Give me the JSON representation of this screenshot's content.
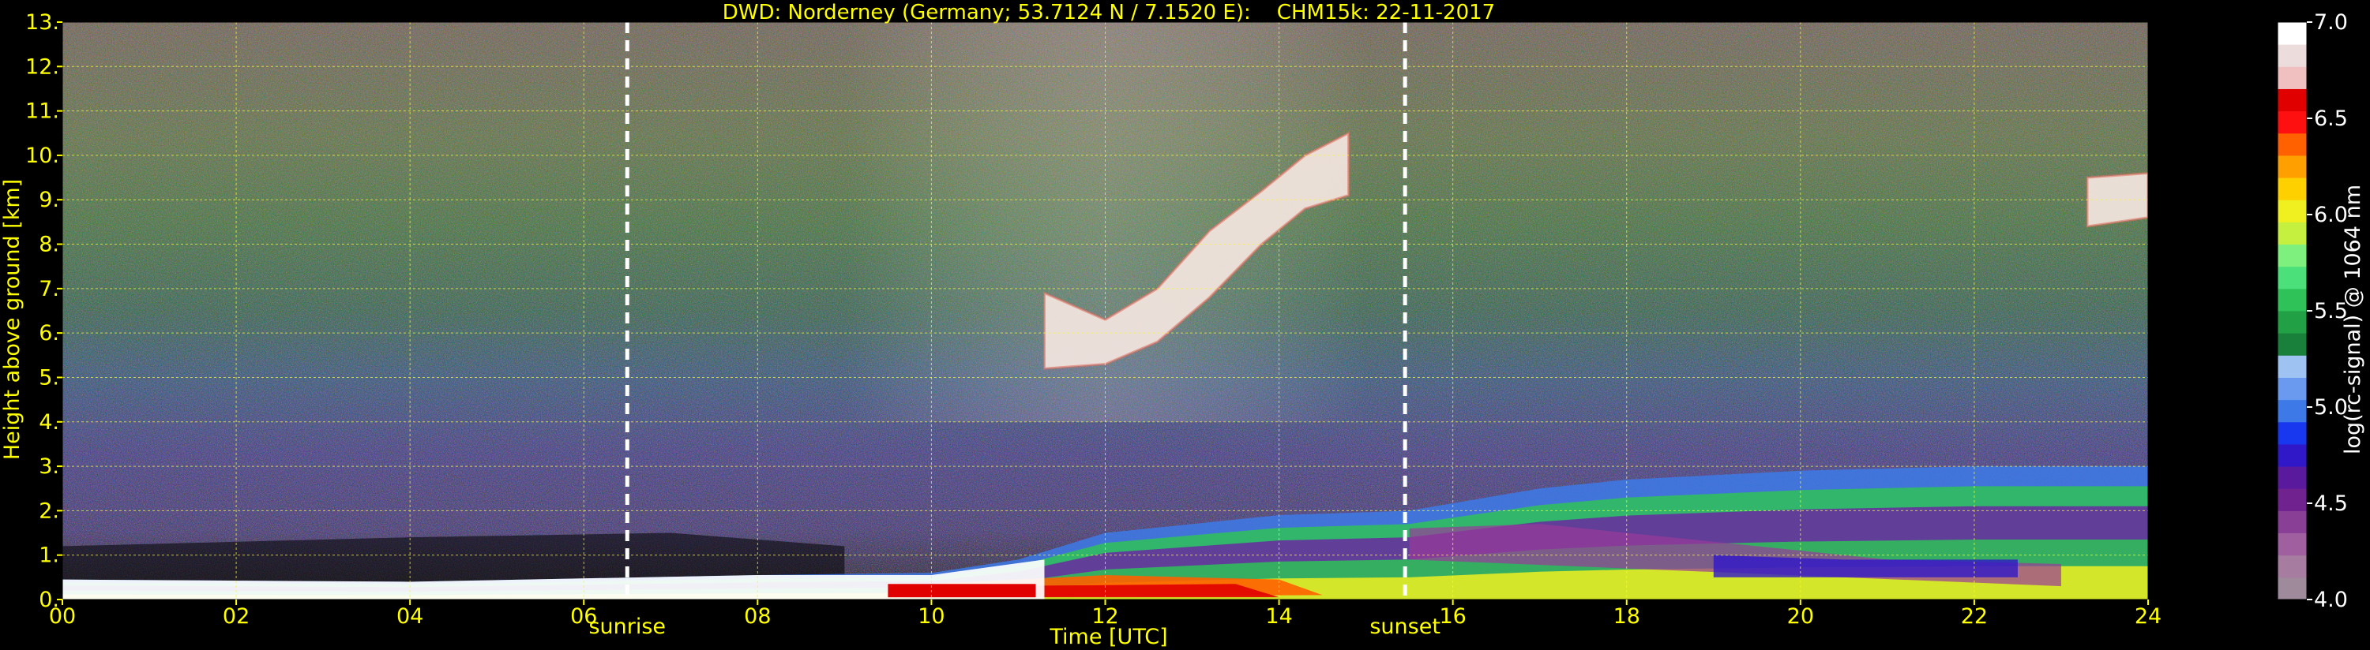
{
  "chart_data": {
    "type": "heatmap",
    "title": "DWD: Norderney (Germany; 53.7124 N / 7.1520 E):    CHM15k: 22-11-2017",
    "xlabel": "Time [UTC]",
    "ylabel": "Height above ground [km]",
    "xlim": [
      0,
      24
    ],
    "ylim": [
      0,
      13
    ],
    "x_ticks": [
      "00",
      "02",
      "04",
      "06",
      "08",
      "10",
      "12",
      "14",
      "16",
      "18",
      "20",
      "22",
      "24"
    ],
    "y_ticks": [
      "0.",
      "1.",
      "2.",
      "3.",
      "4.",
      "5.",
      "6.",
      "7.",
      "8.",
      "9.",
      "10.",
      "11.",
      "12.",
      "13."
    ],
    "grid": true,
    "annotations": [
      {
        "label": "sunrise",
        "time": 6.5
      },
      {
        "label": "sunset",
        "time": 15.45
      }
    ],
    "colorbar": {
      "label": "log(rc-signal) @ 1064 nm",
      "range": [
        4.0,
        7.0
      ],
      "ticks": [
        "4.0",
        "4.5",
        "5.0",
        "5.5",
        "6.0",
        "6.5",
        "7.0"
      ],
      "colors": [
        "#9e8a9b",
        "#a67ca1",
        "#a060a0",
        "#8a3f96",
        "#70238f",
        "#5a1a9e",
        "#3018c8",
        "#1838f0",
        "#3d7ae8",
        "#6a9af0",
        "#9ec2f2",
        "#18803a",
        "#22a045",
        "#2fc258",
        "#4ce07a",
        "#7ef07e",
        "#c6f040",
        "#f0f020",
        "#ffd000",
        "#ffa000",
        "#ff6000",
        "#ff1010",
        "#e00000",
        "#f0c0c0",
        "#ecdcdc",
        "#ffffff"
      ]
    },
    "features": {
      "aerosol_layer_top_km": [
        [
          0,
          0.45
        ],
        [
          4,
          0.4
        ],
        [
          8,
          0.55
        ],
        [
          10,
          0.6
        ],
        [
          11,
          0.9
        ],
        [
          12,
          1.5
        ],
        [
          14,
          1.9
        ],
        [
          15.5,
          2.0
        ],
        [
          17,
          2.5
        ],
        [
          18,
          2.7
        ],
        [
          20,
          2.9
        ],
        [
          22,
          3.0
        ],
        [
          24,
          3.0
        ]
      ],
      "cirrus_cloud": [
        [
          11.3,
          5.2,
          6.9
        ],
        [
          12,
          5.3,
          6.3
        ],
        [
          12.6,
          5.8,
          7.0
        ],
        [
          13.2,
          6.8,
          8.3
        ],
        [
          13.8,
          8.0,
          9.2
        ],
        [
          14.3,
          8.8,
          10.0
        ],
        [
          14.8,
          9.1,
          10.5
        ]
      ],
      "late_cloud": [
        [
          23.3,
          8.4,
          9.5
        ],
        [
          24,
          8.6,
          9.6
        ]
      ]
    }
  }
}
